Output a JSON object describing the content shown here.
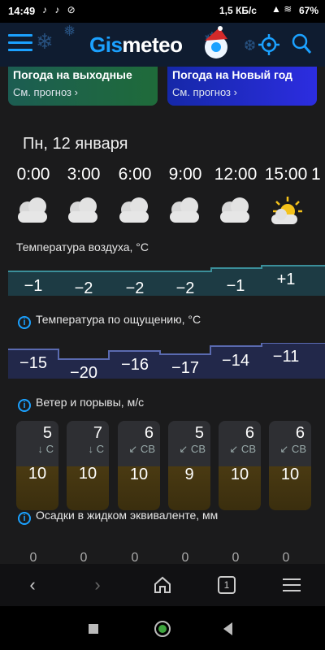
{
  "status": {
    "time": "14:49",
    "notif_icons": "♪ ♪ ⊘",
    "speed": "1,5 КБ/с",
    "battery": "67%"
  },
  "header": {
    "logo_part1": "Gis",
    "logo_part2": "meteo",
    "accent_color": "#1ba1ff"
  },
  "cards": [
    {
      "title": "Погода на выходные",
      "link": "См. прогноз ›"
    },
    {
      "title": "Погода на Новый год",
      "link": "См. прогноз ›"
    }
  ],
  "day": {
    "title": "Пн, 12 января"
  },
  "hours": [
    "0:00",
    "3:00",
    "6:00",
    "9:00",
    "12:00",
    "15:00"
  ],
  "conditions": [
    "cloudy-icon",
    "cloudy-icon",
    "cloudy-icon",
    "cloudy-icon",
    "cloudy-icon",
    "partly-cloudy-icon"
  ],
  "air_temp": {
    "label": "Температура воздуха, °C",
    "values": [
      "−1",
      "−2",
      "−2",
      "−2",
      "−1",
      "+1"
    ]
  },
  "feels_like": {
    "label": "Температура по ощущению, °C",
    "values": [
      "−15",
      "−20",
      "−16",
      "−17",
      "−14",
      "−11"
    ]
  },
  "wind": {
    "label": "Ветер и порывы, м/с",
    "speeds": [
      "5",
      "7",
      "6",
      "5",
      "6",
      "6"
    ],
    "directions": [
      "↓ С",
      "↓ С",
      "↙ СВ",
      "↙ СВ",
      "↙ СВ",
      "↙ СВ"
    ],
    "gusts": [
      "10",
      "10",
      "10",
      "9",
      "10",
      "10"
    ]
  },
  "precip": {
    "label": "Осадки в жидком эквиваленте, мм",
    "values": [
      "0",
      "0",
      "0",
      "0",
      "0",
      "0"
    ]
  },
  "nav": {
    "back": "‹",
    "forward": "›",
    "tabs_count": "1"
  }
}
